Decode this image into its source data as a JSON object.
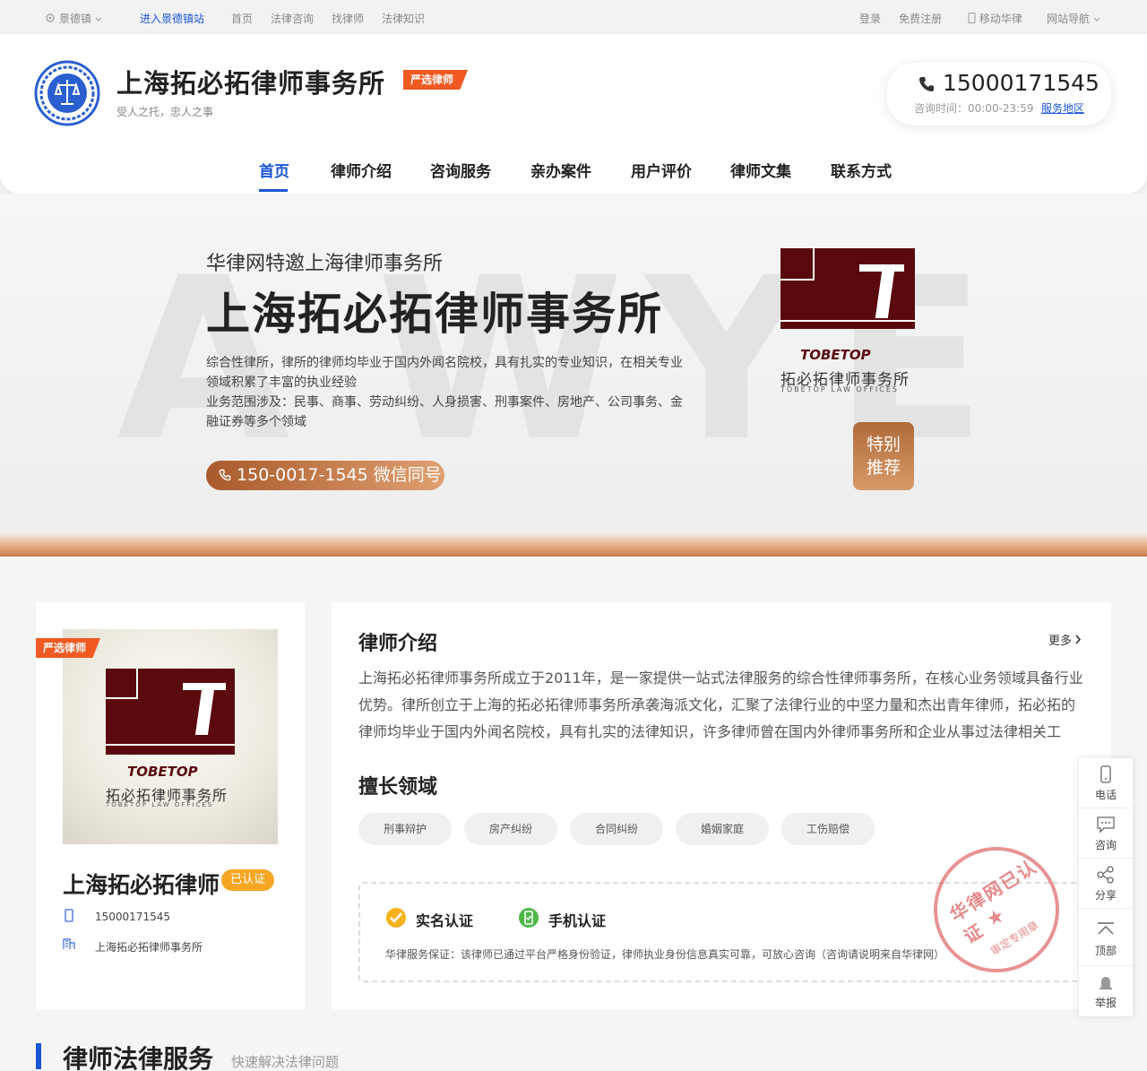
{
  "topbar": {
    "location": "景德镇",
    "enter_site": "进入景德镇站",
    "links": [
      "首页",
      "法律咨询",
      "找律师",
      "法律知识"
    ],
    "login": "登录",
    "register": "免费注册",
    "mobile": "移动华律",
    "site_nav": "网站导航"
  },
  "header": {
    "title": "上海拓必拓律师事务所",
    "tag": "严选律师",
    "slogan": "受人之托，忠人之事",
    "phone": "15000171545",
    "hours": "咨询时间：00:00-23:59",
    "service_area": "服务地区"
  },
  "nav": [
    "首页",
    "律师介绍",
    "咨询服务",
    "亲办案件",
    "用户评价",
    "律师文集",
    "联系方式"
  ],
  "banner": {
    "subtitle": "华律网特邀上海律师事务所",
    "title": "上海拓必拓律师事务所",
    "desc1": "综合性律所，律所的律师均毕业于国内外闻名院校，具有扎实的专业知识，在相关专业领域积累了丰富的执业经验",
    "desc2": "业务范围涉及：民事、商事、劳动纠纷、人身损害、刑事案件、房地产、公司事务、金融证券等多个领域",
    "tel": "150-0017-1545  微信同号",
    "recommend": [
      "特别",
      "推荐"
    ],
    "logo_en": "TOBETOP",
    "logo_cn": "拓必拓律师事务所",
    "logo_sub": "TOBETOP  LAW  OFFICES",
    "bg_letters": [
      "A",
      "W",
      "Y",
      "E"
    ]
  },
  "lawyer_card": {
    "tag": "严选律师",
    "name": "上海拓必拓律师",
    "verified": "已认证",
    "phone": "15000171545",
    "firm": "上海拓必拓律师事务所"
  },
  "intro": {
    "title": "律师介绍",
    "more": "更多",
    "text": "上海拓必拓律师事务所成立于2011年，是一家提供一站式法律服务的综合性律师事务所，在核心业务领域具备行业优势。律所创立于上海的拓必拓律师事务所承袭海派文化，汇聚了法律行业的中坚力量和杰出青年律师，拓必拓的律师均毕业于国内外闻名院校，具有扎实的法律知识，许多律师曾在国内外律师事务所和企业从事过法律相关工",
    "expertise_title": "擅长领域",
    "expertise": [
      "刑事辩护",
      "房产纠纷",
      "合同纠纷",
      "婚姻家庭",
      "工伤赔偿"
    ],
    "cert_real": "实名认证",
    "cert_phone": "手机认证",
    "cert_note": "华律服务保证：该律师已通过平台严格身份验证，律师执业身份信息真实可靠，可放心咨询（咨询请说明来自华律网）",
    "seal_text": "华律网已认证",
    "seal_sub": "审定专用章"
  },
  "sidebar": [
    "电话",
    "咨询",
    "分享",
    "顶部",
    "举报"
  ],
  "bottom": {
    "title": "律师法律服务",
    "subtitle": "快速解决法律问题"
  },
  "colors": {
    "accent": "#1a56d6",
    "tag": "#f05a22",
    "brand": "#5a0a0e",
    "banner_btn": "#c07a4a"
  }
}
